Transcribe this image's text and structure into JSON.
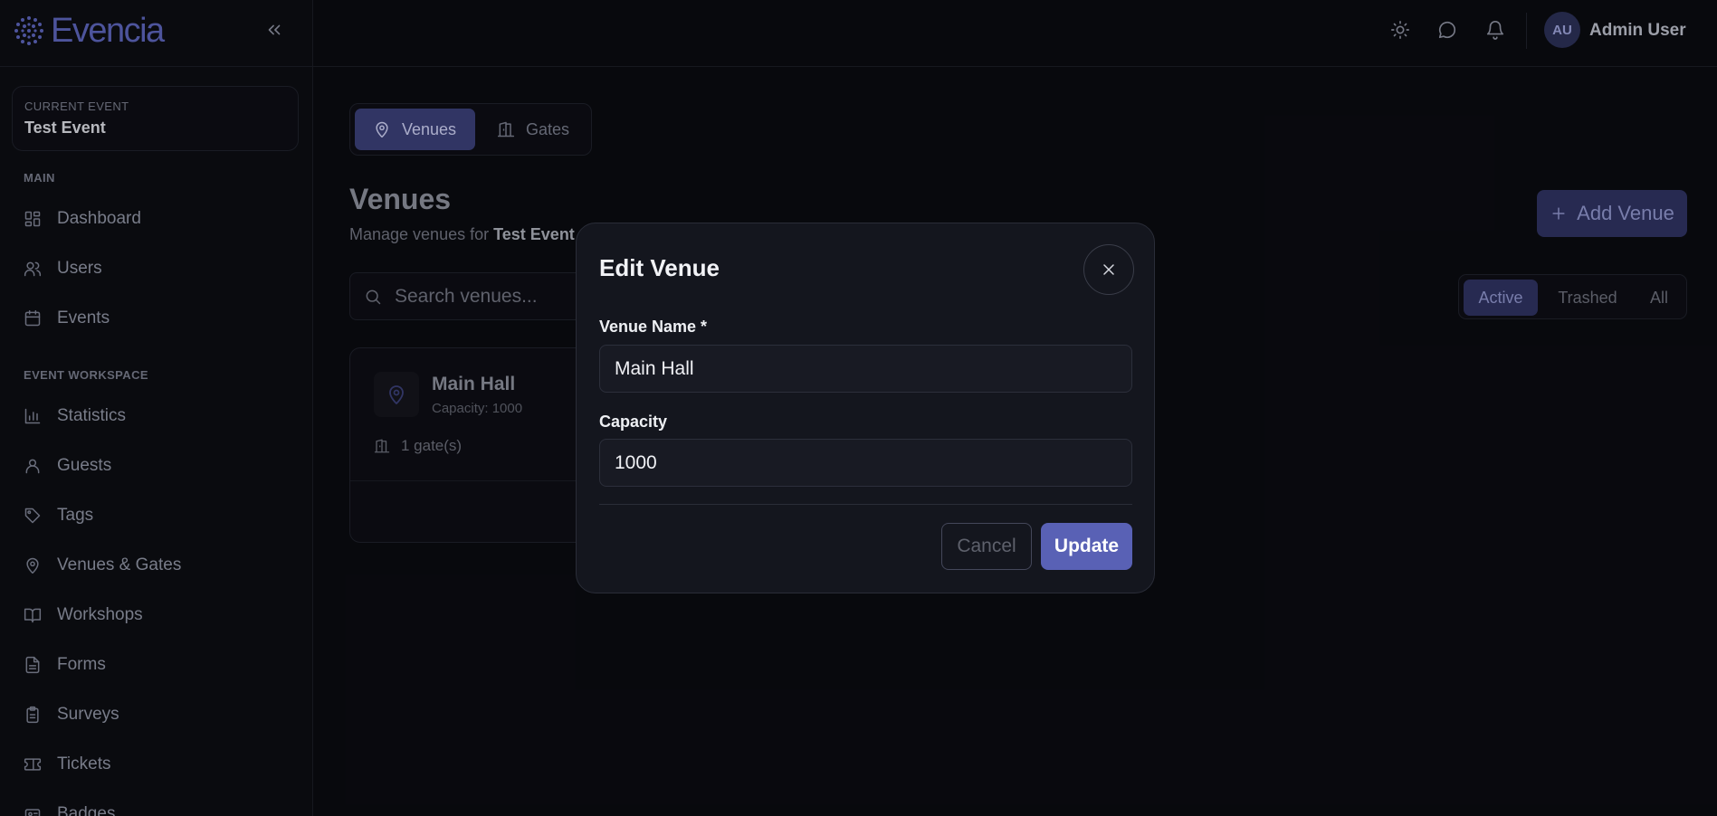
{
  "app": {
    "brand": "Evencia",
    "accent": "#5961b5"
  },
  "sidebar": {
    "current_event_label": "CURRENT EVENT",
    "current_event": "Test Event",
    "section_main": "MAIN",
    "section_workspace": "EVENT WORKSPACE",
    "main_items": [
      {
        "label": "Dashboard",
        "icon": "dashboard-icon"
      },
      {
        "label": "Users",
        "icon": "users-icon"
      },
      {
        "label": "Events",
        "icon": "calendar-icon"
      }
    ],
    "workspace_items": [
      {
        "label": "Statistics",
        "icon": "chart-icon"
      },
      {
        "label": "Guests",
        "icon": "user-icon"
      },
      {
        "label": "Tags",
        "icon": "tag-icon"
      },
      {
        "label": "Venues & Gates",
        "icon": "map-pin-icon"
      },
      {
        "label": "Workshops",
        "icon": "book-icon"
      },
      {
        "label": "Forms",
        "icon": "file-icon"
      },
      {
        "label": "Surveys",
        "icon": "clipboard-icon"
      },
      {
        "label": "Tickets",
        "icon": "ticket-icon"
      },
      {
        "label": "Badges",
        "icon": "badge-icon"
      }
    ]
  },
  "topbar": {
    "avatar_initials": "AU",
    "user_name": "Admin User"
  },
  "main": {
    "tabs": [
      {
        "label": "Venues",
        "active": true
      },
      {
        "label": "Gates",
        "active": false
      }
    ],
    "title": "Venues",
    "subtitle_prefix": "Manage venues for ",
    "subtitle_event": "Test Event",
    "add_button": "Add Venue",
    "search_placeholder": "Search venues...",
    "filters": [
      {
        "label": "Active",
        "active": true
      },
      {
        "label": "Trashed",
        "active": false
      },
      {
        "label": "All",
        "active": false
      }
    ],
    "card": {
      "title": "Main Hall",
      "capacity": "Capacity: 1000",
      "gates": "1 gate(s)"
    }
  },
  "modal": {
    "title": "Edit Venue",
    "name_label": "Venue Name *",
    "name_value": "Main Hall",
    "capacity_label": "Capacity",
    "capacity_value": "1000",
    "cancel": "Cancel",
    "update": "Update"
  }
}
